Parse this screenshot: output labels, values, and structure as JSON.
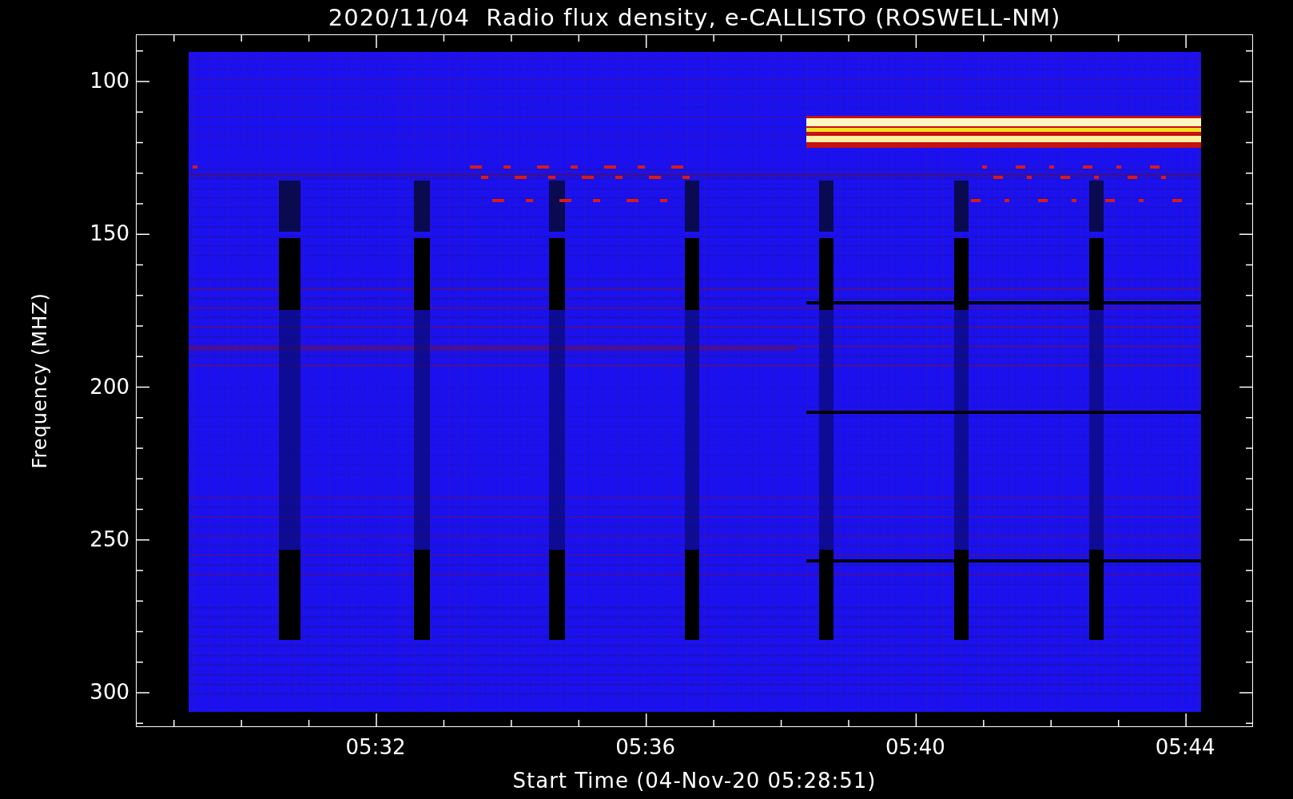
{
  "title": "2020/11/04  Radio flux density, e-CALLISTO (ROSWELL-NM)",
  "y_axis": {
    "label": "Frequency (MHZ)",
    "ticks": [
      "100",
      "150",
      "200",
      "250",
      "300"
    ]
  },
  "x_axis": {
    "label": "Start Time (04-Nov-20 05:28:51)",
    "ticks": [
      "05:32",
      "05:36",
      "05:40",
      "05:44"
    ]
  }
}
